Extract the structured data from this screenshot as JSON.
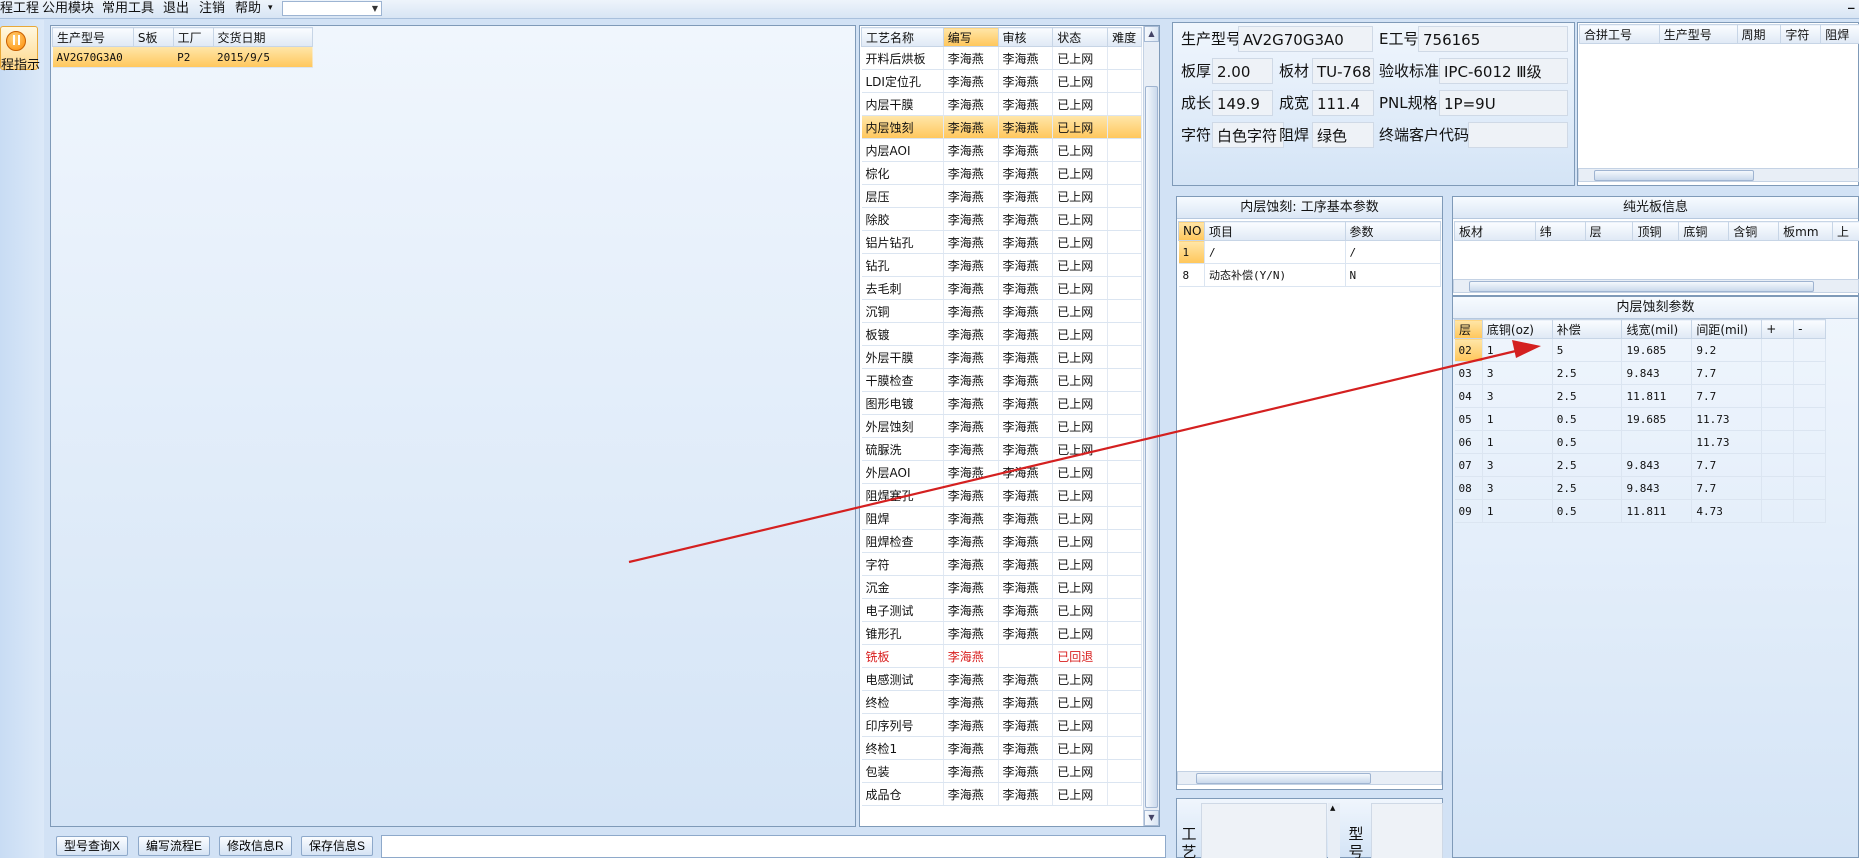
{
  "menu": {
    "items": [
      "程工程",
      "公用模块",
      "常用工具",
      "退出",
      "注销",
      "帮助"
    ],
    "help_arrow": "▾",
    "combo_value": "",
    "corner_glyph": "_"
  },
  "side": {
    "guide_label": "程指示"
  },
  "order_table": {
    "headers": [
      "生产型号",
      "S板",
      "工厂",
      "交货日期"
    ],
    "rows": [
      [
        "AV2G70G3A0",
        "",
        "P2",
        "2015/9/5"
      ]
    ]
  },
  "process_table": {
    "headers": [
      "工艺名称",
      "编写",
      "审核",
      "状态",
      "难度"
    ],
    "rows": [
      [
        "开料后烘板",
        "李海燕",
        "李海燕",
        "已上网",
        ""
      ],
      [
        "LDI定位孔",
        "李海燕",
        "李海燕",
        "已上网",
        ""
      ],
      [
        "内层干膜",
        "李海燕",
        "李海燕",
        "已上网",
        ""
      ],
      [
        "内层蚀刻",
        "李海燕",
        "李海燕",
        "已上网",
        ""
      ],
      [
        "内层AOI",
        "李海燕",
        "李海燕",
        "已上网",
        ""
      ],
      [
        "棕化",
        "李海燕",
        "李海燕",
        "已上网",
        ""
      ],
      [
        "层压",
        "李海燕",
        "李海燕",
        "已上网",
        ""
      ],
      [
        "除胶",
        "李海燕",
        "李海燕",
        "已上网",
        ""
      ],
      [
        "铝片钻孔",
        "李海燕",
        "李海燕",
        "已上网",
        ""
      ],
      [
        "钻孔",
        "李海燕",
        "李海燕",
        "已上网",
        ""
      ],
      [
        "去毛刺",
        "李海燕",
        "李海燕",
        "已上网",
        ""
      ],
      [
        "沉铜",
        "李海燕",
        "李海燕",
        "已上网",
        ""
      ],
      [
        "板镀",
        "李海燕",
        "李海燕",
        "已上网",
        ""
      ],
      [
        "外层干膜",
        "李海燕",
        "李海燕",
        "已上网",
        ""
      ],
      [
        "干膜检查",
        "李海燕",
        "李海燕",
        "已上网",
        ""
      ],
      [
        "图形电镀",
        "李海燕",
        "李海燕",
        "已上网",
        ""
      ],
      [
        "外层蚀刻",
        "李海燕",
        "李海燕",
        "已上网",
        ""
      ],
      [
        "硫脲洗",
        "李海燕",
        "李海燕",
        "已上网",
        ""
      ],
      [
        "外层AOI",
        "李海燕",
        "李海燕",
        "已上网",
        ""
      ],
      [
        "阻焊塞孔",
        "李海燕",
        "李海燕",
        "已上网",
        ""
      ],
      [
        "阻焊",
        "李海燕",
        "李海燕",
        "已上网",
        ""
      ],
      [
        "阻焊检查",
        "李海燕",
        "李海燕",
        "已上网",
        ""
      ],
      [
        "字符",
        "李海燕",
        "李海燕",
        "已上网",
        ""
      ],
      [
        "沉金",
        "李海燕",
        "李海燕",
        "已上网",
        ""
      ],
      [
        "电子测试",
        "李海燕",
        "李海燕",
        "已上网",
        ""
      ],
      [
        "锥形孔",
        "李海燕",
        "李海燕",
        "已上网",
        ""
      ],
      [
        "铣板",
        "李海燕",
        "",
        "已回退",
        ""
      ],
      [
        "电感测试",
        "李海燕",
        "李海燕",
        "已上网",
        ""
      ],
      [
        "终检",
        "李海燕",
        "李海燕",
        "已上网",
        ""
      ],
      [
        "印序列号",
        "李海燕",
        "李海燕",
        "已上网",
        ""
      ],
      [
        "终检1",
        "李海燕",
        "李海燕",
        "已上网",
        ""
      ],
      [
        "包装",
        "李海燕",
        "李海燕",
        "已上网",
        ""
      ],
      [
        "成品仓",
        "李海燕",
        "李海燕",
        "已上网",
        ""
      ]
    ]
  },
  "info": {
    "model_label": "生产型号",
    "model": "AV2G70G3A0",
    "e_label": "E工号",
    "e_no": "756165",
    "thick_label": "板厚",
    "thick": "2.00",
    "material_label": "板材",
    "material": "TU-768",
    "std_label": "验收标准",
    "std": "IPC-6012 Ⅲ级",
    "len_label": "成长",
    "len": "149.9",
    "width_label": "成宽",
    "width": "111.4",
    "pnl_label": "PNL规格",
    "pnl": "1P=9U",
    "char_label": "字符",
    "char": "白色字符",
    "mask_label": "阻焊",
    "mask": "绿色",
    "cust_label": "终端客户代码",
    "cust": ""
  },
  "merge_table": {
    "headers": [
      "合拼工号",
      "生产型号",
      "周期",
      "字符",
      "阻焊"
    ]
  },
  "process_params": {
    "title": "内层蚀刻: 工序基本参数",
    "headers": [
      "NO",
      "项目",
      "参数"
    ],
    "rows": [
      [
        "1",
        "/",
        "/"
      ],
      [
        "8",
        "动态补偿(Y/N)",
        "N"
      ]
    ]
  },
  "plain_board": {
    "title": "纯光板信息",
    "headers": [
      "板材",
      "纬",
      "层",
      "顶铜",
      "底铜",
      "含铜",
      "板mm",
      "上"
    ]
  },
  "etch_params": {
    "title": "内层蚀刻参数",
    "headers": [
      "层",
      "底铜(oz)",
      "补偿",
      "线宽(mil)",
      "间距(mil)",
      "+",
      "-"
    ],
    "rows": [
      [
        "02",
        "1",
        "5",
        "19.685",
        "9.2"
      ],
      [
        "03",
        "3",
        "2.5",
        "9.843",
        "7.7"
      ],
      [
        "04",
        "3",
        "2.5",
        "11.811",
        "7.7"
      ],
      [
        "05",
        "1",
        "0.5",
        "19.685",
        "11.73"
      ],
      [
        "06",
        "1",
        "0.5",
        "",
        "11.73"
      ],
      [
        "07",
        "3",
        "2.5",
        "9.843",
        "7.7"
      ],
      [
        "08",
        "3",
        "2.5",
        "9.843",
        "7.7"
      ],
      [
        "09",
        "1",
        "0.5",
        "11.811",
        "4.73"
      ]
    ]
  },
  "bottom_left": {
    "label_a": "工艺",
    "label_b": "型号"
  },
  "toolbar": {
    "query": "型号查询X",
    "write": "编写流程E",
    "modify": "修改信息R",
    "save": "保存信息S"
  },
  "annotation": {
    "arrow_color": "#d42020"
  },
  "colors": {
    "accent": "#ffc65a",
    "panel": "#d4e4f6",
    "returned": "#d81e1e"
  }
}
